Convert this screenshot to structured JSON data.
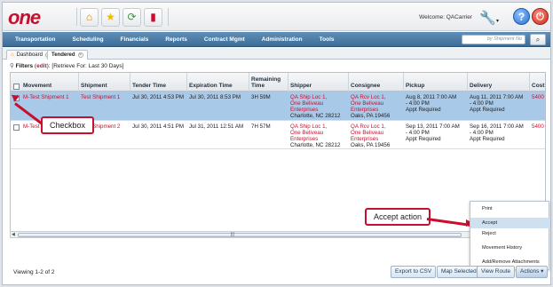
{
  "header": {
    "logo": "one",
    "welcome": "Welcome: QACarrier",
    "icons": [
      "home-icon",
      "star-icon",
      "refresh-icon",
      "chart-icon"
    ]
  },
  "nav": {
    "items": [
      "Transportation",
      "Scheduling",
      "Financials",
      "Reports",
      "Contract Mgmt",
      "Administration",
      "Tools"
    ],
    "search_placeholder": "by Shipment No"
  },
  "tabs": [
    {
      "label": "Dashboard"
    },
    {
      "label": "Tendered"
    }
  ],
  "filters": {
    "label": "Filters",
    "edit": "edit",
    "retrieve": "[Retrieve For: Last 30 Days]"
  },
  "grid": {
    "columns": [
      "Movement",
      "Shipment",
      "Tender Time",
      "Expiration Time",
      "Remaining Time",
      "Shipper",
      "Consignee",
      "Pickup",
      "Delivery",
      "Cost"
    ],
    "rows": [
      {
        "checked": true,
        "movement": "M-Test Shipment 1",
        "shipment": "Test Shipment 1",
        "tender": "Jul 30, 2011 4:53 PM",
        "expiration": "Jul 30, 2011 8:53 PM",
        "remaining": "3H 59M",
        "shipper": [
          "QA Ship Loc 1,",
          "One Beliveau",
          "Enterprises",
          "Charlotte, NC 28212"
        ],
        "consignee": [
          "QA Rcv Loc 1,",
          "One Beliveau",
          "Enterprises",
          "Oaks, PA 19456"
        ],
        "pickup": [
          "Aug 8, 2011 7:00 AM",
          "- 4:00 PM",
          "Appt Required"
        ],
        "delivery": [
          "Aug 11, 2011 7:00 AM",
          "- 4:00 PM",
          "Appt Required"
        ],
        "cost": "5400"
      },
      {
        "checked": false,
        "movement": "M-Test Shipment 2",
        "shipment": "Test Shipment 2",
        "tender": "Jul 30, 2011 4:51 PM",
        "expiration": "Jul 31, 2011 12:51 AM",
        "remaining": "7H 57M",
        "shipper": [
          "QA Ship Loc 1,",
          "One Beliveau",
          "Enterprises",
          "Charlotte, NC 28212"
        ],
        "consignee": [
          "QA Rcv Loc 1,",
          "One Beliveau",
          "Enterprises",
          "Oaks, PA 19456"
        ],
        "pickup": [
          "Sep 13, 2011 7:00 AM",
          "- 4:00 PM",
          "Appt Required"
        ],
        "delivery": [
          "Sep 16, 2011 7:00 AM",
          "- 4:00 PM",
          "Appt Required"
        ],
        "cost": "5400"
      }
    ]
  },
  "callouts": {
    "checkbox": "Checkbox",
    "accept_action": "Accept action"
  },
  "actions_menu": [
    "Print",
    "Accept",
    "Reject",
    "Movement History",
    "Add/Remove Attachments"
  ],
  "footer": {
    "viewing": "Viewing 1-2 of 2",
    "buttons": [
      "Export to CSV",
      "Map Selected",
      "View Route",
      "Actions"
    ]
  },
  "colors": {
    "brand_red": "#c8102e",
    "nav_blue": "#4a78a3",
    "selected_row": "#a9c9e8"
  }
}
